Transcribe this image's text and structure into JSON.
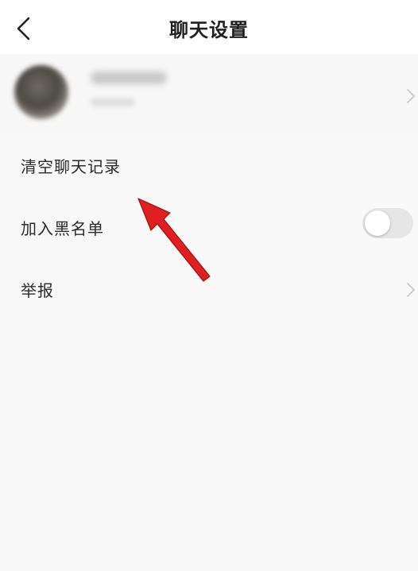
{
  "header": {
    "title": "聊天设置",
    "back_icon": "chevron-left-icon"
  },
  "profile": {
    "chevron_icon": "chevron-right-icon"
  },
  "settings": {
    "clear_history": {
      "label": "清空聊天记录"
    },
    "blacklist": {
      "label": "加入黑名单",
      "enabled": false
    },
    "report": {
      "label": "举报",
      "chevron_icon": "chevron-right-icon"
    }
  },
  "annotation": {
    "arrow_icon": "red-arrow-icon",
    "color": "#e02020"
  }
}
